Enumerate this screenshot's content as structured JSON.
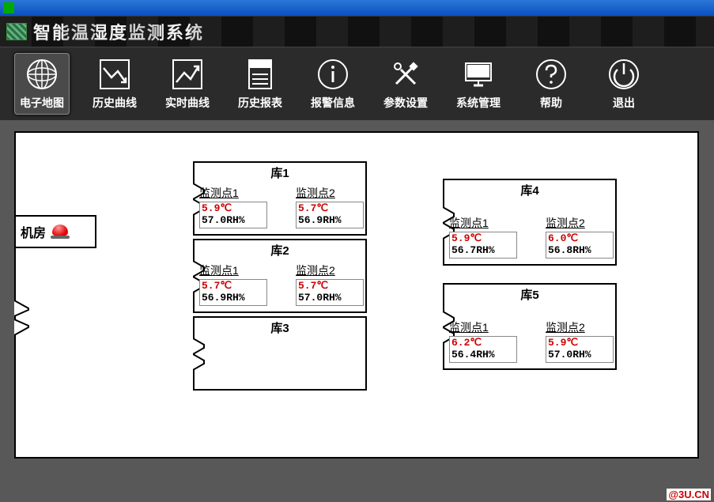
{
  "titlebar": {
    "title": ""
  },
  "app_title": "智能温湿度监测系统",
  "toolbar": [
    {
      "id": "map",
      "label": "电子地图",
      "active": true
    },
    {
      "id": "history",
      "label": "历史曲线",
      "active": false
    },
    {
      "id": "realtime",
      "label": "实时曲线",
      "active": false
    },
    {
      "id": "report",
      "label": "历史报表",
      "active": false
    },
    {
      "id": "alarm",
      "label": "报警信息",
      "active": false
    },
    {
      "id": "params",
      "label": "参数设置",
      "active": false
    },
    {
      "id": "system",
      "label": "系统管理",
      "active": false
    },
    {
      "id": "help",
      "label": "帮助",
      "active": false
    },
    {
      "id": "exit",
      "label": "退出",
      "active": false
    }
  ],
  "machine_room": {
    "label": "机房"
  },
  "warehouses": {
    "w1": {
      "title": "库1",
      "p1": {
        "name": "监测点1",
        "temp": "5.9℃",
        "hum": "57.0RH%"
      },
      "p2": {
        "name": "监测点2",
        "temp": "5.7℃",
        "hum": "56.9RH%"
      }
    },
    "w2": {
      "title": "库2",
      "p1": {
        "name": "监测点1",
        "temp": "5.7℃",
        "hum": "56.9RH%"
      },
      "p2": {
        "name": "监测点2",
        "temp": "5.7℃",
        "hum": "57.0RH%"
      }
    },
    "w3": {
      "title": "库3"
    },
    "w4": {
      "title": "库4",
      "p1": {
        "name": "监测点1",
        "temp": "5.9℃",
        "hum": "56.7RH%"
      },
      "p2": {
        "name": "监测点2",
        "temp": "6.0℃",
        "hum": "56.8RH%"
      }
    },
    "w5": {
      "title": "库5",
      "p1": {
        "name": "监测点1",
        "temp": "6.2℃",
        "hum": "56.4RH%"
      },
      "p2": {
        "name": "监测点2",
        "temp": "5.9℃",
        "hum": "57.0RH%"
      }
    }
  },
  "watermark": "@3U.CN"
}
